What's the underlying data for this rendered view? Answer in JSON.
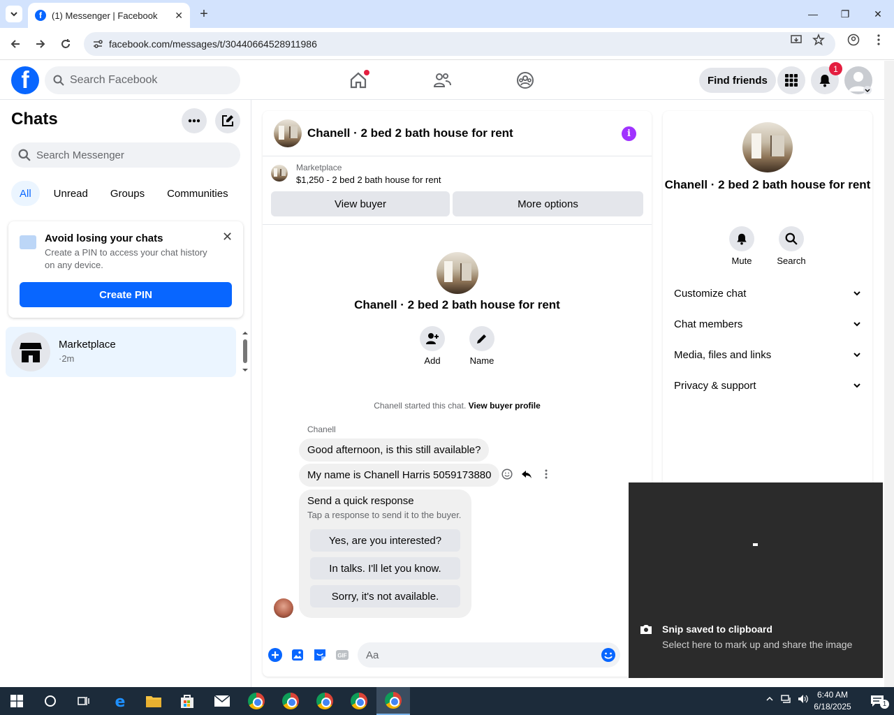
{
  "browser": {
    "tab_title": "(1) Messenger | Facebook",
    "url": "facebook.com/messages/t/30440664528911986"
  },
  "fb": {
    "search_placeholder": "Search Facebook",
    "find_friends": "Find friends",
    "notification_count": "1"
  },
  "left": {
    "title": "Chats",
    "search_placeholder": "Search Messenger",
    "filters": [
      "All",
      "Unread",
      "Groups",
      "Communities"
    ],
    "pin_card": {
      "title": "Avoid losing your chats",
      "desc": "Create a PIN to access your chat history on any device.",
      "button": "Create PIN"
    },
    "chats": [
      {
        "name": "Marketplace",
        "time": "·2m"
      }
    ]
  },
  "conversation": {
    "title": "Chanell · 2 bed 2 bath house for rent",
    "marketplace_label": "Marketplace",
    "listing": "$1,250 - 2 bed 2 bath house for rent",
    "view_buyer": "View buyer",
    "more_options": "More options",
    "actions": {
      "add": "Add",
      "name": "Name"
    },
    "started_text": "Chanell started this chat.",
    "view_buyer_profile": "View buyer profile",
    "sender": "Chanell",
    "messages": [
      "Good afternoon, is this still available?",
      "My name is Chanell Harris 5059173880"
    ],
    "quick_response": {
      "title": "Send a quick response",
      "subtitle": "Tap a response to send it to the buyer.",
      "options": [
        "Yes, are you interested?",
        "In talks. I'll let you know.",
        "Sorry, it's not available."
      ]
    },
    "composer_placeholder": "Aa"
  },
  "details": {
    "name": "Chanell · 2 bed 2 bath house for rent",
    "mute": "Mute",
    "search": "Search",
    "sections": [
      "Customize chat",
      "Chat members",
      "Media, files and links",
      "Privacy & support"
    ]
  },
  "toast": {
    "title": "Snip saved to clipboard",
    "subtitle": "Select here to mark up and share the image"
  },
  "taskbar": {
    "time": "6:40 AM",
    "date": "6/18/2025",
    "notification_count": "1"
  },
  "colors": {
    "fb_blue": "#0866ff",
    "notification_red": "#e41e3f",
    "info_purple": "#a033ff"
  }
}
